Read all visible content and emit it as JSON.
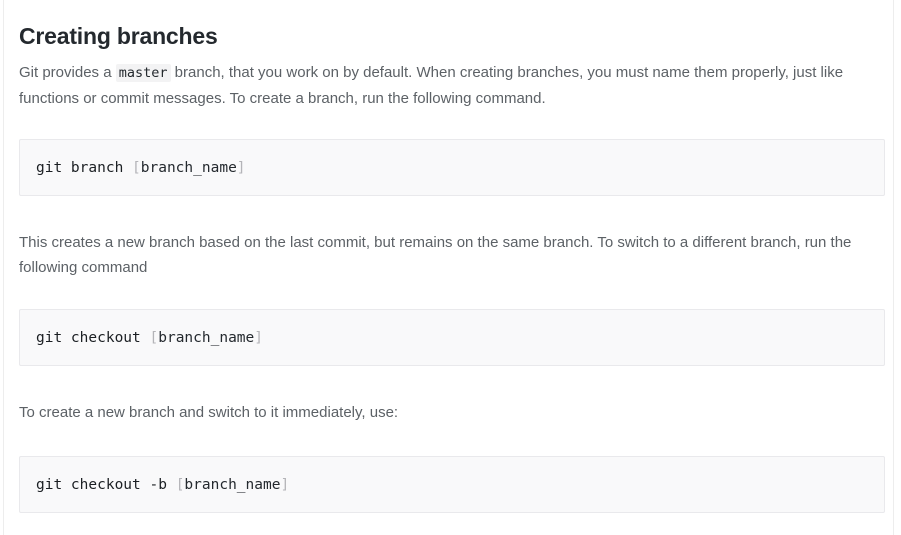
{
  "page": {
    "title": "Creating branches",
    "background_color": "#ffffff",
    "text_color": "#5c6166",
    "heading_color": "#24292e"
  },
  "paragraphs": {
    "p1_before_code": "Git provides a ",
    "p1_inline_code": "master",
    "p1_after_code": " branch, that you work on by default. When creating branches, you must name them properly, just like functions or commit messages. To create a branch, run the following command.",
    "p2": "This creates a new branch based on the last commit, but remains on the same branch. To switch to a different branch, run the following command",
    "p3": "To create a new branch and switch to it immediately, use:"
  },
  "code_blocks": [
    {
      "full_text": "git branch [branch_name]",
      "command": "git branch ",
      "open_bracket": "[",
      "argument": "branch_name",
      "close_bracket": "]",
      "background_color": "#f9f9fa",
      "border_color": "#e9e9ec"
    },
    {
      "full_text": "git checkout [branch_name]",
      "command": "git checkout ",
      "open_bracket": "[",
      "argument": "branch_name",
      "close_bracket": "]",
      "background_color": "#f9f9fa",
      "border_color": "#e9e9ec"
    },
    {
      "full_text": "git checkout -b [branch_name]",
      "command": "git checkout -b ",
      "open_bracket": "[",
      "argument": "branch_name",
      "close_bracket": "]",
      "background_color": "#f9f9fa",
      "border_color": "#e9e9ec"
    }
  ]
}
